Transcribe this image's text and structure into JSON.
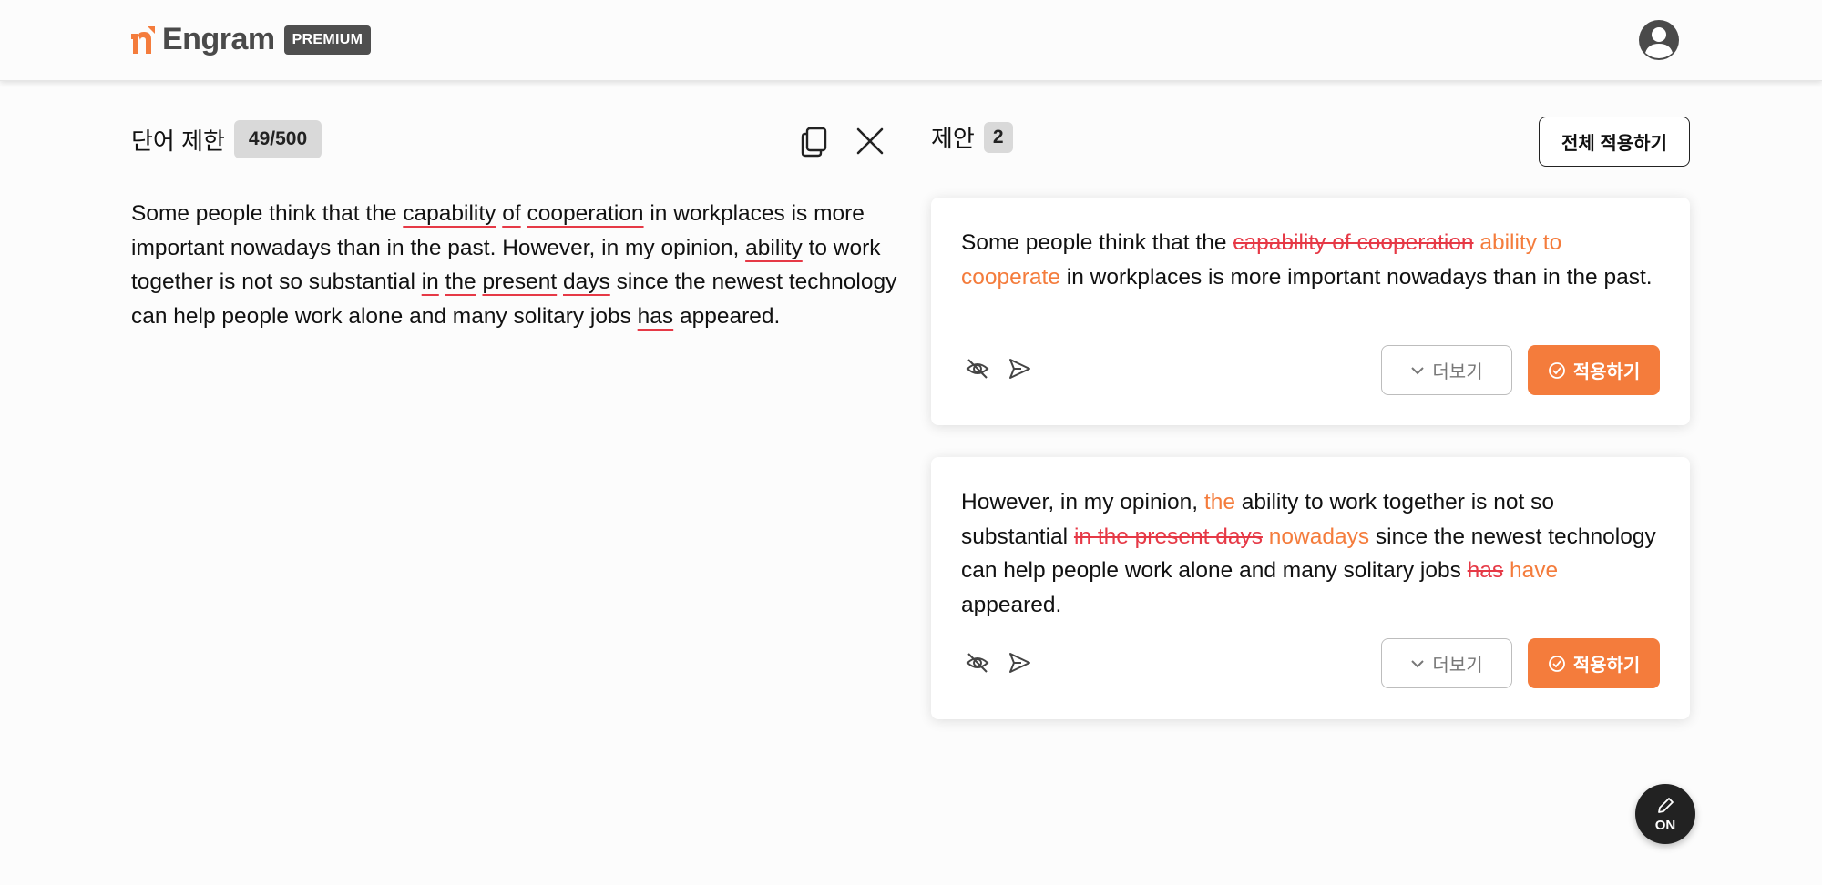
{
  "header": {
    "brand": "Engram",
    "badge": "PREMIUM",
    "colors": {
      "brand_accent": "#f47c3c",
      "brand_text": "#4a4a4a"
    }
  },
  "editor": {
    "word_limit_label": "단어 제한",
    "word_count": "49/500",
    "segments": [
      {
        "text": "Some people think that the ",
        "error": false
      },
      {
        "text": "capability",
        "error": true
      },
      {
        "text": " ",
        "error": false
      },
      {
        "text": "of",
        "error": true
      },
      {
        "text": " ",
        "error": false
      },
      {
        "text": "cooperation",
        "error": true
      },
      {
        "text": " in workplaces is more important nowadays than in the past. However, in my opinion, ",
        "error": false
      },
      {
        "text": "ability",
        "error": true
      },
      {
        "text": " to work together is not so substantial ",
        "error": false
      },
      {
        "text": "in",
        "error": true
      },
      {
        "text": " ",
        "error": false
      },
      {
        "text": "the",
        "error": true
      },
      {
        "text": " ",
        "error": false
      },
      {
        "text": "present",
        "error": true
      },
      {
        "text": " ",
        "error": false
      },
      {
        "text": "days",
        "error": true
      },
      {
        "text": " since the newest technology can help people work alone and many solitary jobs ",
        "error": false
      },
      {
        "text": "has",
        "error": true
      },
      {
        "text": " appeared.",
        "error": false
      }
    ],
    "icons": {
      "copy": "copy-icon",
      "close": "close-icon"
    }
  },
  "suggestions": {
    "label": "제안",
    "count": "2",
    "apply_all_label": "전체 적용하기",
    "more_label": "더보기",
    "apply_label": "적용하기",
    "colors": {
      "deleted": "#e63946",
      "inserted": "#f47c3c"
    },
    "cards": [
      {
        "segments": [
          {
            "text": "Some people think that the ",
            "kind": "plain"
          },
          {
            "text": "capability of cooperation",
            "kind": "del"
          },
          {
            "text": " ",
            "kind": "plain"
          },
          {
            "text": "ability to cooperate",
            "kind": "ins"
          },
          {
            "text": " in workplaces is more important nowadays than in the past.",
            "kind": "plain"
          }
        ]
      },
      {
        "segments": [
          {
            "text": "However, in my opinion, ",
            "kind": "plain"
          },
          {
            "text": "the",
            "kind": "ins"
          },
          {
            "text": " ability to work together is not so substantial ",
            "kind": "plain"
          },
          {
            "text": "in the present days",
            "kind": "del"
          },
          {
            "text": " ",
            "kind": "plain"
          },
          {
            "text": "nowadays",
            "kind": "ins"
          },
          {
            "text": " since the newest technology can help people work alone and many solitary jobs ",
            "kind": "plain"
          },
          {
            "text": "has",
            "kind": "del"
          },
          {
            "text": " ",
            "kind": "plain"
          },
          {
            "text": "have",
            "kind": "ins"
          },
          {
            "text": " appeared.",
            "kind": "plain"
          }
        ]
      }
    ]
  },
  "fab": {
    "label": "ON",
    "icon": "pencil-icon"
  }
}
